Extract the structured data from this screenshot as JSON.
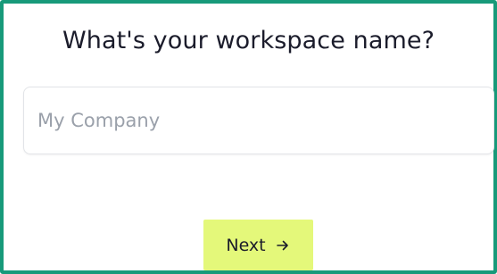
{
  "form": {
    "title": "What's your workspace name?",
    "workspace_input": {
      "value": "",
      "placeholder": "My Company"
    },
    "next_button": {
      "label": "Next",
      "icon": "arrow-right-icon"
    }
  },
  "colors": {
    "frame_border": "#179a7a",
    "button_background": "#e4f87a",
    "text": "#1b1c2b",
    "placeholder": "#9aa0aa"
  }
}
